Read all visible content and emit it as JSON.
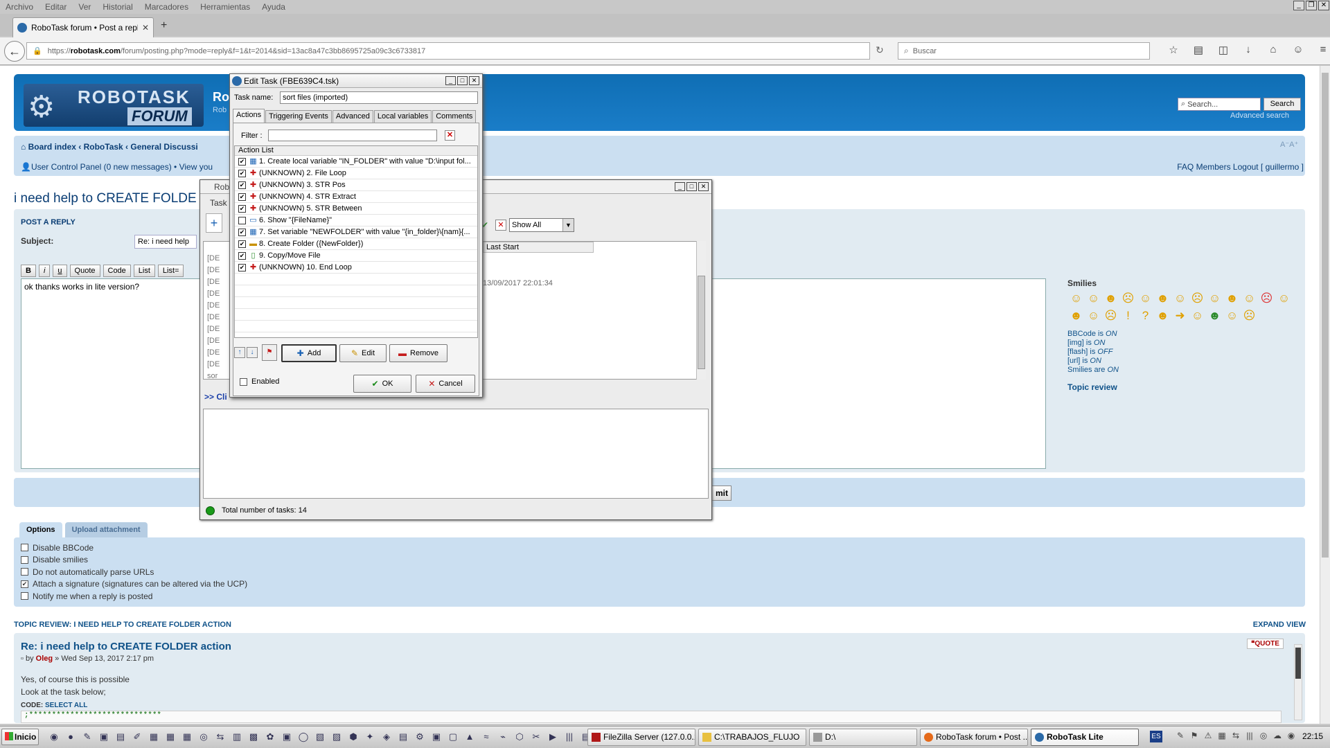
{
  "browser": {
    "menu": [
      "Archivo",
      "Editar",
      "Ver",
      "Historial",
      "Marcadores",
      "Herramientas",
      "Ayuda"
    ],
    "tab_title": "RoboTask forum • Post a reply",
    "url_prefix": "https://",
    "url_domain": "robotask.com",
    "url_path": "/forum/posting.php?mode=reply&f=1&t=2014&sid=13ac8a47c3bb8695725a09c3c6733817",
    "search_placeholder": "Buscar"
  },
  "forum": {
    "logo_top": "ROBOTASK",
    "logo_bottom": "FORUM",
    "header_title": "Ro",
    "header_sub": "Rob",
    "search_placeholder": "Search...",
    "search_button": "Search",
    "advanced_search": "Advanced search",
    "breadcrumb": "Board index ‹ RoboTask ‹ General Discussi",
    "ucp": "User Control Panel (0 new messages) • View you",
    "right_links": "FAQ   Members   Logout [ guillermo ]",
    "font_size": "A⁻A⁺",
    "page_title": "i need help to CREATE FOLDE",
    "post_a_reply": "POST A REPLY",
    "subject_label": "Subject:",
    "subject_value": "Re: i need help",
    "bbcode_buttons": [
      "B",
      "i",
      "u",
      "Quote",
      "Code",
      "List",
      "List="
    ],
    "message": "ok thanks works in lite version?",
    "smilies_label": "Smilies",
    "bbcode_info": [
      {
        "label": "BBCode",
        "suffix": " is ",
        "state": "ON"
      },
      {
        "label": "[img]",
        "suffix": " is ",
        "state": "ON"
      },
      {
        "label": "[flash]",
        "suffix": " is ",
        "state": "OFF"
      },
      {
        "label": "[url]",
        "suffix": " is ",
        "state": "ON"
      },
      {
        "label": "Smilies",
        "suffix": " are ",
        "state": "ON"
      }
    ],
    "topic_review_link": "Topic review",
    "submit_label": "mit",
    "options_tab": "Options",
    "upload_tab": "Upload attachment",
    "options": [
      {
        "label": "Disable BBCode",
        "checked": false
      },
      {
        "label": "Disable smilies",
        "checked": false
      },
      {
        "label": "Do not automatically parse URLs",
        "checked": false
      },
      {
        "label": "Attach a signature (signatures can be altered via the UCP)",
        "checked": true
      },
      {
        "label": "Notify me when a reply is posted",
        "checked": false
      }
    ],
    "topic_review_heading": "TOPIC REVIEW: I NEED HELP TO CREATE FOLDER ACTION",
    "expand_view": "EXPAND VIEW",
    "review_post_title": "Re: i need help to CREATE FOLDER action",
    "review_by_prefix": "by",
    "review_author": "Oleg",
    "review_date": "» Wed Sep 13, 2017 2:17 pm",
    "review_line1": "Yes, of course this is possible",
    "review_line2": "Look at the task below;",
    "code_label": "CODE:",
    "select_all": "SELECT ALL",
    "code_line": ";*****************************",
    "quote_button": "QUOTE"
  },
  "robotask_window": {
    "title": "Rob",
    "menu": "Task",
    "show_all": "Show All",
    "col_last_start": "Last Start",
    "last_start_value": "13/09/2017 22:01:34",
    "rows": [
      "[DE",
      "[DE",
      "[DE",
      "[DE",
      "[DE",
      "[DE",
      "[DE",
      "[DE",
      "[DE",
      "[DE",
      "sor"
    ],
    "link": ">> Cli",
    "total": "Total number of tasks: 14"
  },
  "edit_dialog": {
    "title": "Edit Task (FBE639C4.tsk)",
    "task_name_label": "Task name:",
    "task_name_value": "sort files (imported)",
    "tabs": [
      "Actions",
      "Triggering Events",
      "Advanced",
      "Local variables",
      "Comments"
    ],
    "filter_label": "Filter :",
    "list_header": "Action List",
    "actions": [
      {
        "text": "1. Create local variable \"IN_FOLDER\" with value \"D:\\input fol...",
        "icon": "variable-icon",
        "color": "blue",
        "checked": true
      },
      {
        "text": "(UNKNOWN) 2. File Loop",
        "icon": "unknown-action-icon",
        "color": "red",
        "checked": true
      },
      {
        "text": "(UNKNOWN) 3. STR Pos",
        "icon": "unknown-action-icon",
        "color": "red",
        "checked": true
      },
      {
        "text": "(UNKNOWN) 4. STR Extract",
        "icon": "unknown-action-icon",
        "color": "red",
        "checked": true
      },
      {
        "text": "(UNKNOWN) 5. STR Between",
        "icon": "unknown-action-icon",
        "color": "red",
        "checked": true
      },
      {
        "text": "6. Show \"{FileName}\"",
        "icon": "message-icon",
        "color": "blue",
        "checked": false
      },
      {
        "text": "7. Set variable \"NEWFOLDER\" with value \"{in_folder}\\{nam}{...",
        "icon": "variable-icon",
        "color": "blue",
        "checked": true
      },
      {
        "text": "8. Create Folder ({NewFolder})",
        "icon": "folder-icon",
        "color": "yel",
        "checked": true
      },
      {
        "text": "9. Copy/Move File",
        "icon": "file-icon",
        "color": "grn",
        "checked": true
      },
      {
        "text": "(UNKNOWN) 10. End Loop",
        "icon": "unknown-action-icon",
        "color": "red",
        "checked": true
      }
    ],
    "add": "Add",
    "edit": "Edit",
    "remove": "Remove",
    "enabled_label": "Enabled",
    "ok": "OK",
    "cancel": "Cancel"
  },
  "taskbar": {
    "start": "Inicio",
    "buttons": [
      {
        "label": "FileZilla Server (127.0.0.1)",
        "active": false
      },
      {
        "label": "C:\\TRABAJOS_FLUJO",
        "active": false
      },
      {
        "label": "D:\\",
        "active": false
      },
      {
        "label": "RoboTask forum • Post ...",
        "active": false
      },
      {
        "label": "RoboTask Lite",
        "active": true
      }
    ],
    "lang": "ES",
    "clock": "22:15"
  },
  "colors": {
    "accent": "#105289",
    "header_blue": "#0f6eb4",
    "panel": "#cbdff1"
  }
}
